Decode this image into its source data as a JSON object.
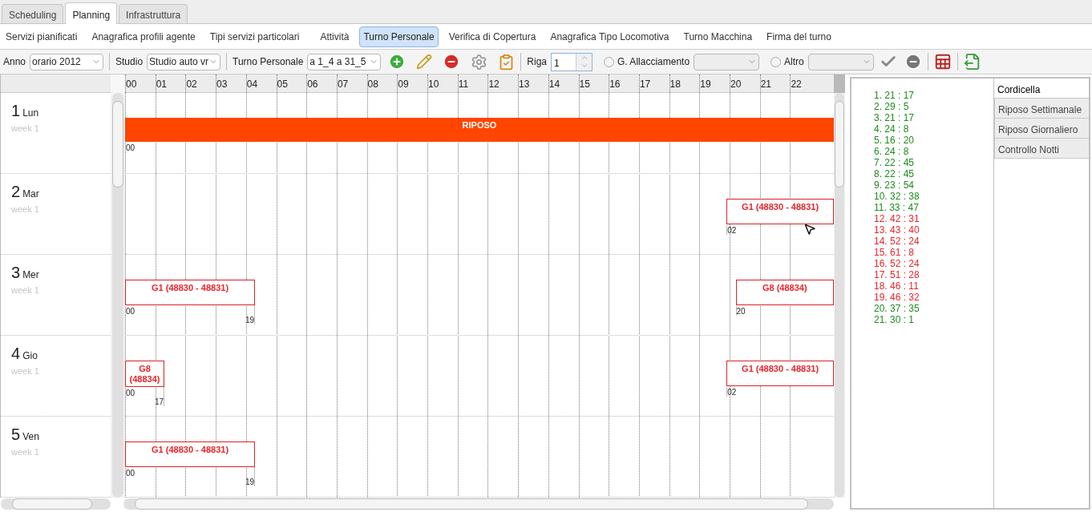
{
  "tabs": [
    {
      "label": "Scheduling",
      "selected": false
    },
    {
      "label": "Planning",
      "selected": true
    },
    {
      "label": "Infrastruttura",
      "selected": false
    }
  ],
  "menu": [
    {
      "label": "Servizi pianificati",
      "selected": false
    },
    {
      "label": "Anagrafica profili agente",
      "selected": false
    },
    {
      "label": "Tipi servizi particolari",
      "selected": false
    },
    {
      "label": "Attività",
      "selected": false
    },
    {
      "label": "Turno Personale",
      "selected": true
    },
    {
      "label": "Verifica di Copertura",
      "selected": false
    },
    {
      "label": "Anagrafica Tipo Locomotiva",
      "selected": false
    },
    {
      "label": "Turno Macchina",
      "selected": false
    },
    {
      "label": "Firma del turno",
      "selected": false
    }
  ],
  "toolbar": {
    "anno": {
      "label": "Anno",
      "value": "orario 2012"
    },
    "studio": {
      "label": "Studio",
      "value": "Studio auto vr"
    },
    "turno": {
      "label": "Turno Personale",
      "value": "a 1_4 a 31_5"
    },
    "riga": {
      "label": "Riga",
      "value": "1"
    },
    "allacciamento": {
      "label": "G. Allacciamento",
      "selected": false
    },
    "altro": {
      "label": "Altro",
      "selected": false
    }
  },
  "hours": [
    "00",
    "01",
    "02",
    "03",
    "04",
    "05",
    "06",
    "07",
    "08",
    "09",
    "10",
    "11",
    "12",
    "13",
    "14",
    "15",
    "16",
    "17",
    "18",
    "19",
    "20",
    "21",
    "22"
  ],
  "days": [
    {
      "number": "1",
      "name": "Lun",
      "week": "week 1",
      "events": [
        {
          "kind": "rest",
          "label": "RIPOSO",
          "start_label": "00"
        }
      ]
    },
    {
      "number": "2",
      "name": "Mar",
      "week": "week 1",
      "events": [
        {
          "kind": "shift",
          "label": "G1 (48830 - 48831)",
          "start_label": "02"
        }
      ]
    },
    {
      "number": "3",
      "name": "Mer",
      "week": "week 1",
      "events": [
        {
          "kind": "shift",
          "label": "G1 (48830 - 48831)",
          "start_label": "00",
          "end_label": "19"
        },
        {
          "kind": "shift",
          "label": "G8 (48834)",
          "start_label": "20"
        }
      ]
    },
    {
      "number": "4",
      "name": "Gio",
      "week": "week 1",
      "events": [
        {
          "kind": "shift",
          "label": "G8 (48834)",
          "start_label": "00",
          "end_label": "17"
        },
        {
          "kind": "shift",
          "label": "G1 (48830 - 48831)",
          "start_label": "02"
        }
      ]
    },
    {
      "number": "5",
      "name": "Ven",
      "week": "week 1",
      "events": [
        {
          "kind": "shift",
          "label": "G1 (48830 - 48831)",
          "start_label": "00",
          "end_label": "19"
        }
      ]
    }
  ],
  "summary": [
    {
      "text": "1. 21 : 17",
      "color": "#1e8c1e"
    },
    {
      "text": "2. 29 : 5",
      "color": "#1e8c1e"
    },
    {
      "text": "3. 21 : 17",
      "color": "#1e8c1e"
    },
    {
      "text": "4. 24 : 8",
      "color": "#1e8c1e"
    },
    {
      "text": "5. 16 : 20",
      "color": "#1e8c1e"
    },
    {
      "text": "6. 24 : 8",
      "color": "#1e8c1e"
    },
    {
      "text": "7. 22 : 45",
      "color": "#1e8c1e"
    },
    {
      "text": "8. 22 : 45",
      "color": "#1e8c1e"
    },
    {
      "text": "9. 23 : 54",
      "color": "#1e8c1e"
    },
    {
      "text": "10. 32 : 38",
      "color": "#1e8c1e"
    },
    {
      "text": "11. 33 : 47",
      "color": "#1e8c1e"
    },
    {
      "text": "12. 42 : 31",
      "color": "#e8262b"
    },
    {
      "text": "13. 43 : 40",
      "color": "#e8262b"
    },
    {
      "text": "14. 52 : 24",
      "color": "#e8262b"
    },
    {
      "text": "15. 61 : 8",
      "color": "#e8262b"
    },
    {
      "text": "16. 52 : 24",
      "color": "#e8262b"
    },
    {
      "text": "17. 51 : 28",
      "color": "#e8262b"
    },
    {
      "text": "18. 46 : 11",
      "color": "#e8262b"
    },
    {
      "text": "19. 46 : 32",
      "color": "#e8262b"
    },
    {
      "text": "20. 37 : 35",
      "color": "#1e8c1e"
    },
    {
      "text": "21. 30 : 1",
      "color": "#1e8c1e"
    }
  ],
  "side_tabs": [
    {
      "label": "Cordicella",
      "selected": true
    },
    {
      "label": "Riposo Settimanale",
      "selected": false
    },
    {
      "label": "Riposo Giornaliero",
      "selected": false
    },
    {
      "label": "Controllo Notti",
      "selected": false
    }
  ]
}
